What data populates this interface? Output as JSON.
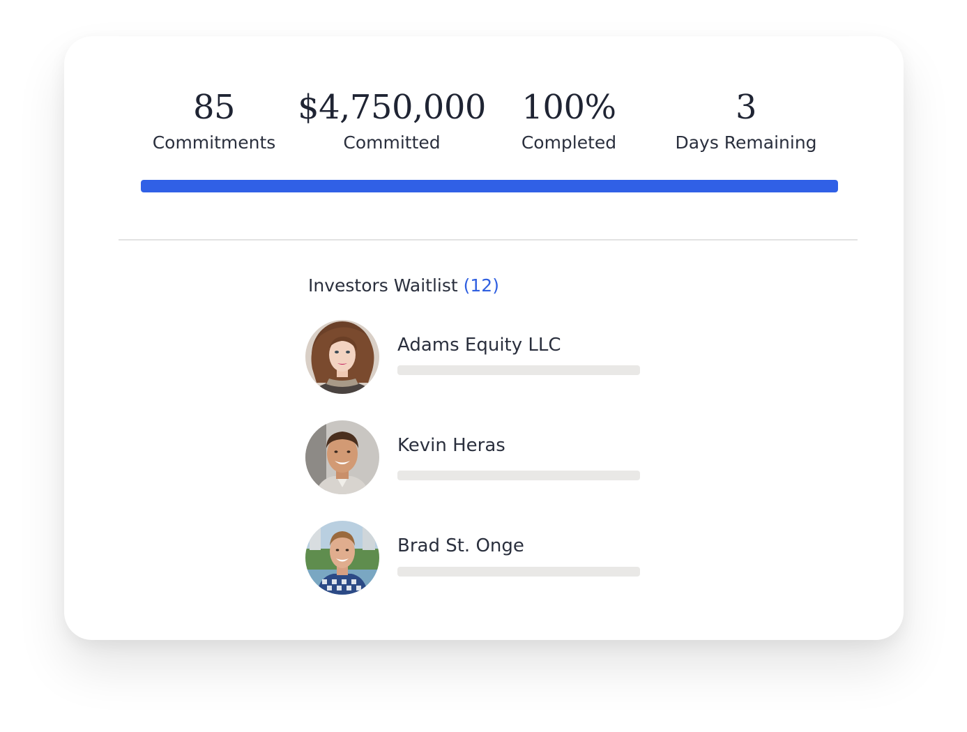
{
  "stats": [
    {
      "value": "85",
      "label": "Commitments"
    },
    {
      "value": "$4,750,000",
      "label": "Committed"
    },
    {
      "value": "100%",
      "label": "Completed"
    },
    {
      "value": "3",
      "label": "Days Remaining"
    }
  ],
  "progress": {
    "fraction": 1.0,
    "color": "#3060e6"
  },
  "waitlist": {
    "title": "Investors Waitlist",
    "count": "(12)",
    "count_color": "#2f5fe0"
  },
  "investors": [
    {
      "name": "Adams Equity LLC",
      "avatar": "woman-curly-hair-portrait"
    },
    {
      "name": "Kevin Heras",
      "avatar": "smiling-man-portrait"
    },
    {
      "name": "Brad St. Onge",
      "avatar": "man-plaid-shirt-outdoor-portrait"
    }
  ]
}
